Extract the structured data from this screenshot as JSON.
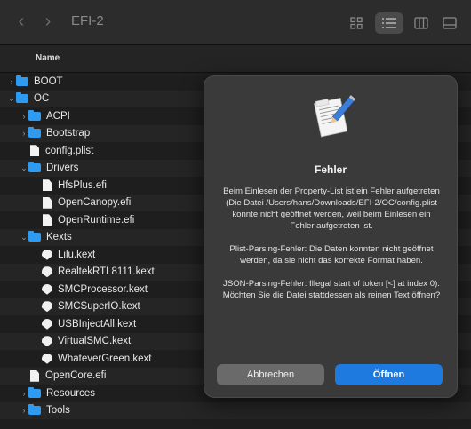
{
  "window": {
    "title": "EFI-2",
    "back_glyph": "‹",
    "forward_glyph": "›"
  },
  "toolbar": {
    "view_icons": [
      "icon-view-icon",
      "list-view-icon",
      "column-view-icon",
      "gallery-view-icon"
    ]
  },
  "header": {
    "name_column": "Name"
  },
  "files": [
    {
      "label": "BOOT",
      "type": "folder",
      "depth": 0,
      "chevron": "›"
    },
    {
      "label": "OC",
      "type": "folder",
      "depth": 0,
      "chevron": "⌄"
    },
    {
      "label": "ACPI",
      "type": "folder",
      "depth": 1,
      "chevron": "›"
    },
    {
      "label": "Bootstrap",
      "type": "folder",
      "depth": 1,
      "chevron": "›"
    },
    {
      "label": "config.plist",
      "type": "file",
      "depth": 1,
      "chevron": ""
    },
    {
      "label": "Drivers",
      "type": "folder",
      "depth": 1,
      "chevron": "⌄"
    },
    {
      "label": "HfsPlus.efi",
      "type": "file",
      "depth": 2,
      "chevron": ""
    },
    {
      "label": "OpenCanopy.efi",
      "type": "file",
      "depth": 2,
      "chevron": ""
    },
    {
      "label": "OpenRuntime.efi",
      "type": "file",
      "depth": 2,
      "chevron": ""
    },
    {
      "label": "Kexts",
      "type": "folder",
      "depth": 1,
      "chevron": "⌄"
    },
    {
      "label": "Lilu.kext",
      "type": "kext",
      "depth": 2,
      "chevron": ""
    },
    {
      "label": "RealtekRTL8111.kext",
      "type": "kext",
      "depth": 2,
      "chevron": ""
    },
    {
      "label": "SMCProcessor.kext",
      "type": "kext",
      "depth": 2,
      "chevron": ""
    },
    {
      "label": "SMCSuperIO.kext",
      "type": "kext",
      "depth": 2,
      "chevron": ""
    },
    {
      "label": "USBInjectAll.kext",
      "type": "kext",
      "depth": 2,
      "chevron": ""
    },
    {
      "label": "VirtualSMC.kext",
      "type": "kext",
      "depth": 2,
      "chevron": ""
    },
    {
      "label": "WhateverGreen.kext",
      "type": "kext",
      "depth": 2,
      "chevron": ""
    },
    {
      "label": "OpenCore.efi",
      "type": "file",
      "depth": 1,
      "chevron": ""
    },
    {
      "label": "Resources",
      "type": "folder",
      "depth": 1,
      "chevron": "›"
    },
    {
      "label": "Tools",
      "type": "folder",
      "depth": 1,
      "chevron": "›"
    }
  ],
  "dialog": {
    "icon": "document-pen-icon",
    "title": "Fehler",
    "message": "Beim Einlesen der Property-List ist ein Fehler aufgetreten (Die Datei /Users/hans/Downloads/EFI-2/OC/config.plist konnte nicht geöffnet werden, weil beim Einlesen ein Fehler aufgetreten ist.\n\nPlist-Parsing-Fehler: Die Daten konnten nicht geöffnet werden, da sie nicht das korrekte Format haben.\n\nJSON-Parsing-Fehler: Illegal start of token [<] at index 0).\nMöchten Sie die Datei stattdessen als reinen Text öffnen?",
    "cancel_label": "Abbrechen",
    "open_label": "Öffnen"
  },
  "colors": {
    "folder": "#2f9bf0",
    "accent_button": "#1f7ae0",
    "dialog_bg": "#3a3a3a"
  }
}
